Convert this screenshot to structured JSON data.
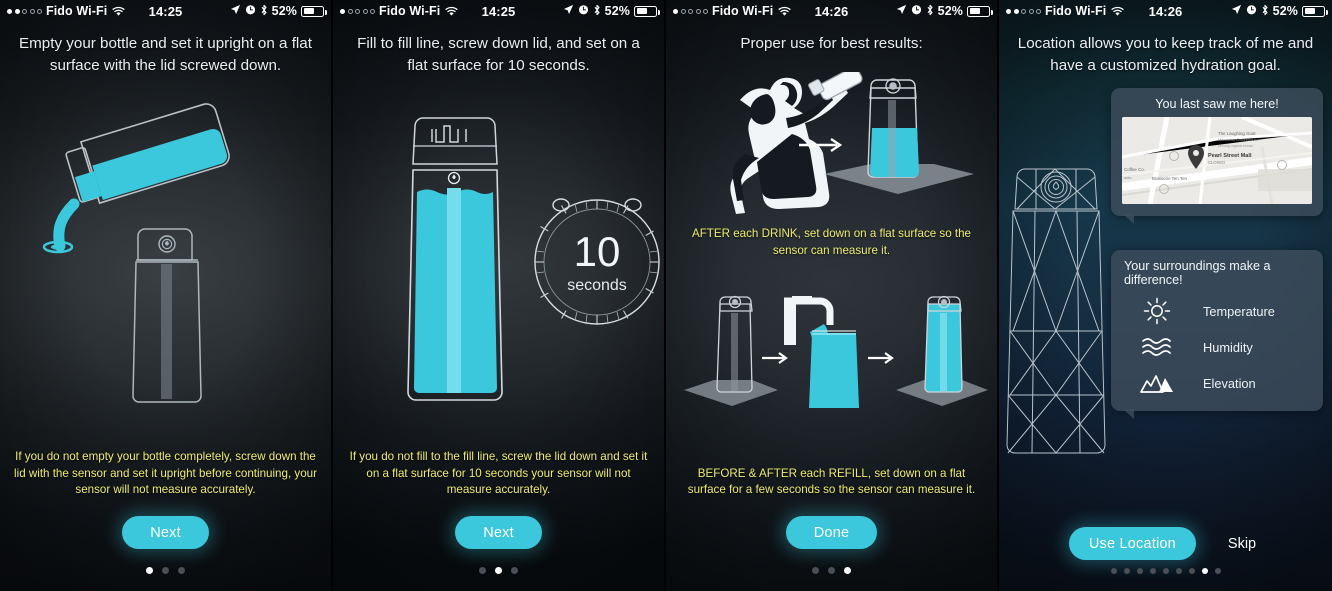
{
  "brand": {
    "accent": "#3cc8dc",
    "caption_color": "#ecec6e",
    "water": "#3cc8dc"
  },
  "screens": [
    {
      "id": "screen-empty-bottle",
      "status": {
        "signal_filled": 2,
        "signal_total": 5,
        "carrier": "Fido Wi-Fi",
        "time": "14:25",
        "battery_pct": "52%"
      },
      "headline": "Empty your bottle and set it upright on a flat surface with the lid screwed down.",
      "caption": "If you do not empty your bottle completely, screw down the lid with the sensor and set it upright before continuing, your sensor will not measure accurately.",
      "button": "Next",
      "dots": {
        "count": 3,
        "active": 0
      }
    },
    {
      "id": "screen-fill-line",
      "status": {
        "signal_filled": 1,
        "signal_total": 5,
        "carrier": "Fido Wi-Fi",
        "time": "14:25",
        "battery_pct": "52%"
      },
      "headline": "Fill to fill line, screw down lid, and set on a flat surface for 10 seconds.",
      "caption": "If you do not fill to the fill line, screw the lid down and set it on a flat surface for 10 seconds your sensor will not measure accurately.",
      "button": "Next",
      "timer": {
        "value": "10",
        "unit": "seconds"
      },
      "dots": {
        "count": 3,
        "active": 1
      }
    },
    {
      "id": "screen-proper-use",
      "status": {
        "signal_filled": 1,
        "signal_total": 5,
        "carrier": "Fido Wi-Fi",
        "time": "14:26",
        "battery_pct": "52%"
      },
      "headline": "Proper use for best results:",
      "caption_mid": "AFTER each DRINK, set down on a flat surface so the sensor can measure it.",
      "caption": "BEFORE & AFTER each REFILL, set down on a flat surface for a few seconds so the sensor can measure it.",
      "button": "Done",
      "dots": {
        "count": 3,
        "active": 2
      }
    },
    {
      "id": "screen-location",
      "status": {
        "signal_filled": 2,
        "signal_total": 5,
        "carrier": "Fido Wi-Fi",
        "time": "14:26",
        "battery_pct": "52%"
      },
      "headline": "Location allows you to keep track of me and have a customized hydration goal.",
      "location_card": {
        "title": "You last saw me here!",
        "map": {
          "pin_label": "Pearl Street Mall",
          "pin_sub": "CLOSED",
          "places": [
            "The Laughing Goat",
            "Meadows Coffeehouse",
            "serving organic brews",
            "Coffee Co.",
            "Brasserie Ten Ten",
            "adio"
          ]
        }
      },
      "surroundings_card": {
        "title": "Your surroundings make a difference!",
        "items": [
          {
            "icon": "sun-icon",
            "label": "Temperature"
          },
          {
            "icon": "waves-icon",
            "label": "Humidity"
          },
          {
            "icon": "mountains-icon",
            "label": "Elevation"
          }
        ]
      },
      "primary_button": "Use Location",
      "secondary_button": "Skip",
      "dots": {
        "count": 9,
        "active": 7
      }
    }
  ]
}
